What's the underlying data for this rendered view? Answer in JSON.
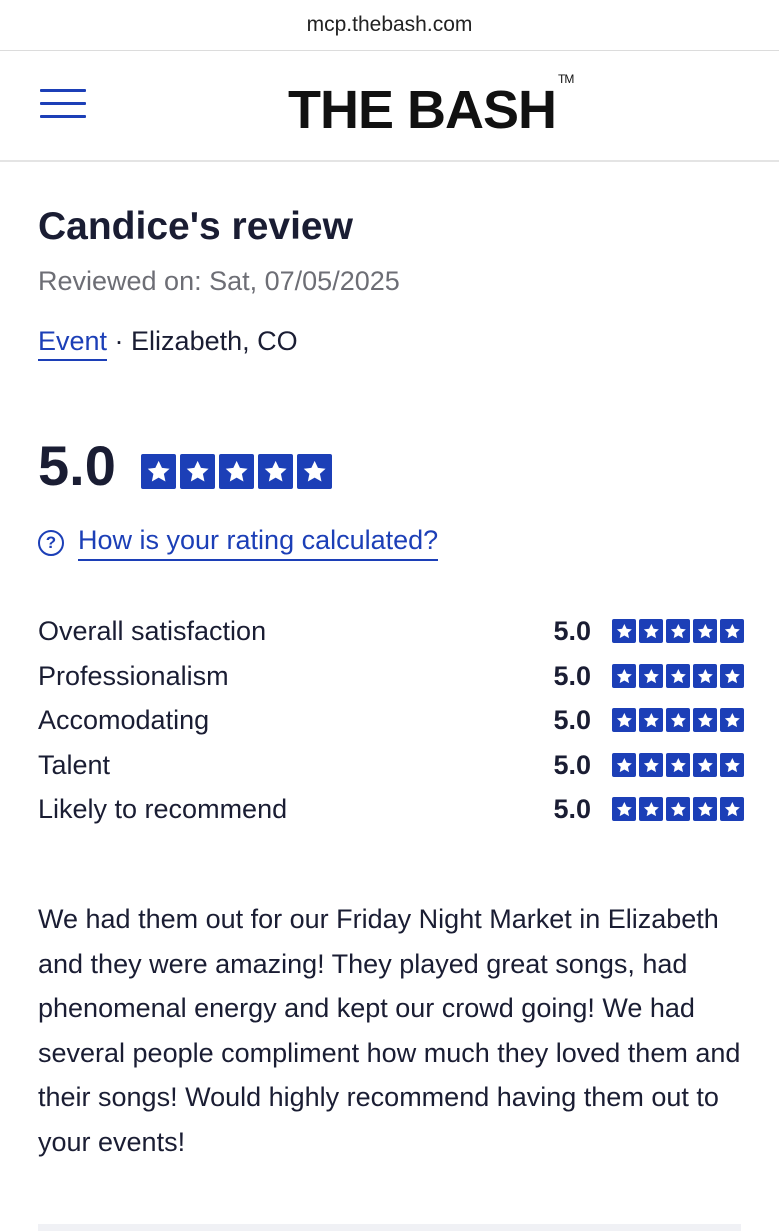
{
  "browser": {
    "url": "mcp.thebash.com"
  },
  "header": {
    "logo_text": "THE BASH",
    "logo_tm": "TM",
    "menu_icon": "hamburger-menu-icon"
  },
  "review": {
    "title": "Candice's review",
    "reviewed_on": "Reviewed on: Sat, 07/05/2025",
    "event_link": "Event",
    "location": " · Elizabeth, CO",
    "overall_score": "5.0",
    "overall_stars": 5,
    "rating_help_text": "How is your rating calculated?",
    "categories": [
      {
        "label": "Overall satisfaction",
        "score": "5.0",
        "stars": 5
      },
      {
        "label": "Professionalism",
        "score": "5.0",
        "stars": 5
      },
      {
        "label": "Accomodating",
        "score": "5.0",
        "stars": 5
      },
      {
        "label": "Talent",
        "score": "5.0",
        "stars": 5
      },
      {
        "label": "Likely to recommend",
        "score": "5.0",
        "stars": 5
      }
    ],
    "body": "We had them out for our Friday Night Market in Elizabeth and they were amazing! They played great songs, had phenomenal energy and kept our crowd going! We had several people compliment how much they loved them and their songs! Would highly recommend having them out to your events!"
  },
  "colors": {
    "brand_blue": "#1c3fb7",
    "text_dark": "#1a1d33",
    "text_muted": "#6d6e75"
  }
}
